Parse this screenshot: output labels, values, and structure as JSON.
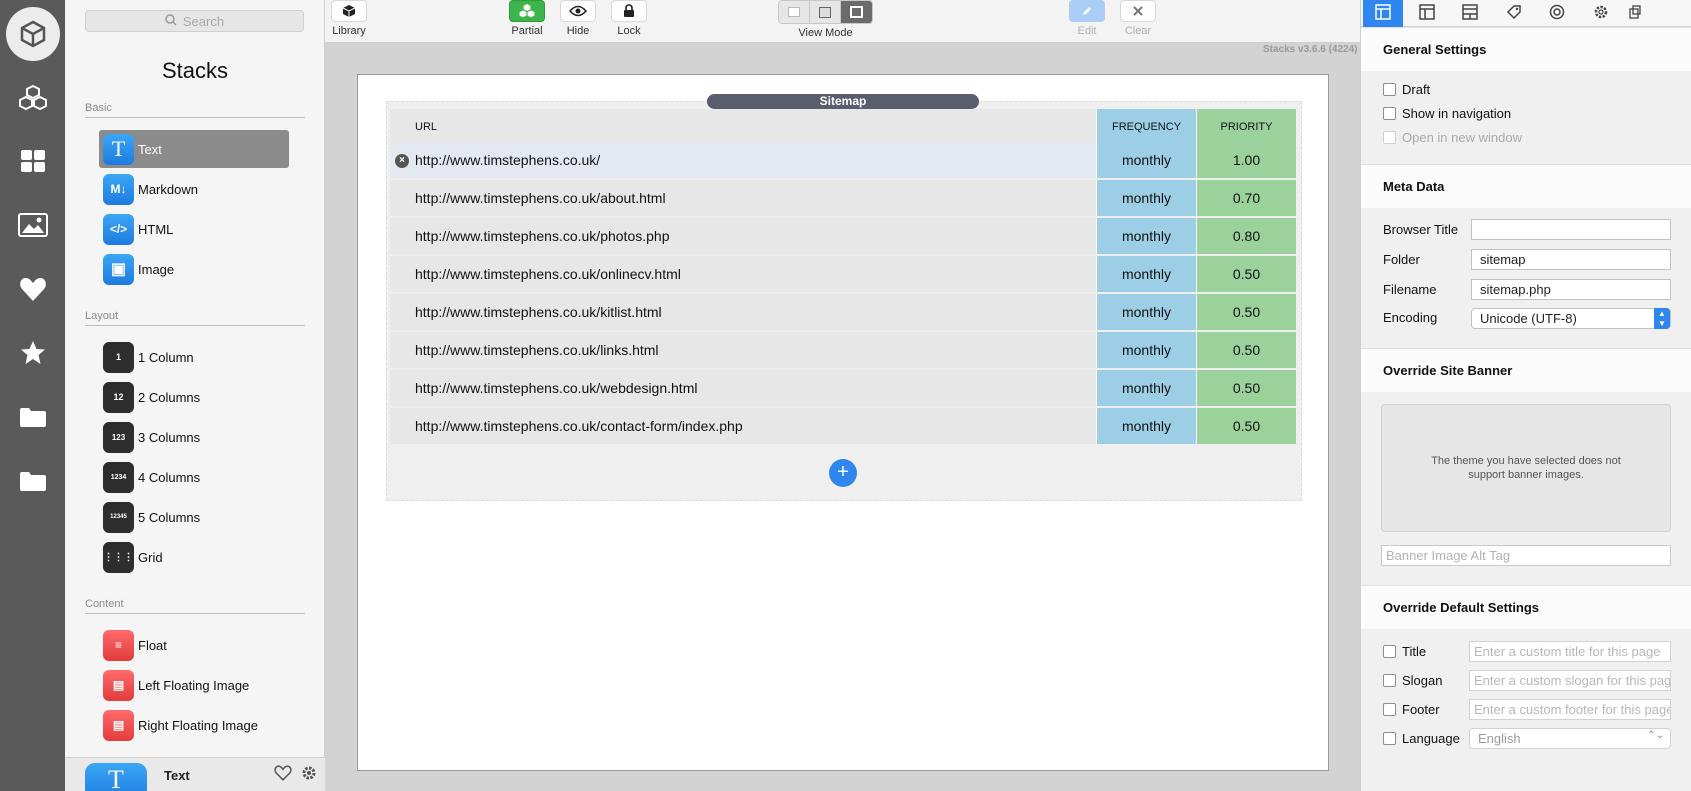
{
  "rail": {
    "items": [
      "stacks-logo",
      "library-cubes",
      "grid-layout",
      "image-library",
      "favorites-heart",
      "starred",
      "folder",
      "folder"
    ]
  },
  "library": {
    "search_placeholder": "Search",
    "title": "Stacks",
    "sections": {
      "basic": "Basic",
      "layout": "Layout",
      "content": "Content"
    },
    "basic_items": [
      {
        "label": "Text",
        "icon": "T"
      },
      {
        "label": "Markdown",
        "icon": "M↓"
      },
      {
        "label": "HTML",
        "icon": "</>"
      },
      {
        "label": "Image",
        "icon": "▣"
      }
    ],
    "layout_items": [
      {
        "label": "1 Column",
        "icon": "1"
      },
      {
        "label": "2 Columns",
        "icon": "12"
      },
      {
        "label": "3 Columns",
        "icon": "123"
      },
      {
        "label": "4 Columns",
        "icon": "1234"
      },
      {
        "label": "5 Columns",
        "icon": "12345"
      },
      {
        "label": "Grid",
        "icon": "⋮⋮⋮"
      }
    ],
    "content_items": [
      {
        "label": "Float"
      },
      {
        "label": "Left Floating Image"
      },
      {
        "label": "Right Floating Image"
      }
    ],
    "footer_label": "Text",
    "footer_icon": "T"
  },
  "toolbar": {
    "library": "Library",
    "partial": "Partial",
    "hide": "Hide",
    "lock": "Lock",
    "view_mode": "View Mode",
    "edit": "Edit",
    "clear": "Clear",
    "version": "Stacks v3.6.6 (4224)"
  },
  "sitemap": {
    "label": "Sitemap",
    "headers": {
      "url": "URL",
      "frequency": "FREQUENCY",
      "priority": "PRIORITY"
    },
    "rows": [
      {
        "url": "http://www.timstephens.co.uk/",
        "frequency": "monthly",
        "priority": "1.00"
      },
      {
        "url": "http://www.timstephens.co.uk/about.html",
        "frequency": "monthly",
        "priority": "0.70"
      },
      {
        "url": "http://www.timstephens.co.uk/photos.php",
        "frequency": "monthly",
        "priority": "0.80"
      },
      {
        "url": "http://www.timstephens.co.uk/onlinecv.html",
        "frequency": "monthly",
        "priority": "0.50"
      },
      {
        "url": "http://www.timstephens.co.uk/kitlist.html",
        "frequency": "monthly",
        "priority": "0.50"
      },
      {
        "url": "http://www.timstephens.co.uk/links.html",
        "frequency": "monthly",
        "priority": "0.50"
      },
      {
        "url": "http://www.timstephens.co.uk/webdesign.html",
        "frequency": "monthly",
        "priority": "0.50"
      },
      {
        "url": "http://www.timstephens.co.uk/contact-form/index.php",
        "frequency": "monthly",
        "priority": "0.50"
      }
    ],
    "add_label": "+"
  },
  "inspector": {
    "general_settings": "General Settings",
    "draft": "Draft",
    "show_in_navigation": "Show in navigation",
    "open_in_new_window": "Open in new window",
    "meta_data": "Meta Data",
    "browser_title_label": "Browser Title",
    "browser_title_value": "",
    "folder_label": "Folder",
    "folder_value": "sitemap",
    "filename_label": "Filename",
    "filename_value": "sitemap.php",
    "encoding_label": "Encoding",
    "encoding_value": "Unicode (UTF-8)",
    "override_site_banner": "Override Site Banner",
    "banner_message": "The theme you have selected does not support banner images.",
    "banner_alt_placeholder": "Banner Image Alt Tag",
    "override_default_settings": "Override Default Settings",
    "title_label": "Title",
    "title_placeholder": "Enter a custom title for this page",
    "slogan_label": "Slogan",
    "slogan_placeholder": "Enter a custom slogan for this page",
    "footer_label": "Footer",
    "footer_placeholder": "Enter a custom footer for this page",
    "language_label": "Language",
    "language_value": "English"
  },
  "colors": {
    "accent": "#2f86ee",
    "frequency_bg": "#9ccfe6",
    "priority_bg": "#9bd19b",
    "rail_bg": "#5a5a5a"
  }
}
